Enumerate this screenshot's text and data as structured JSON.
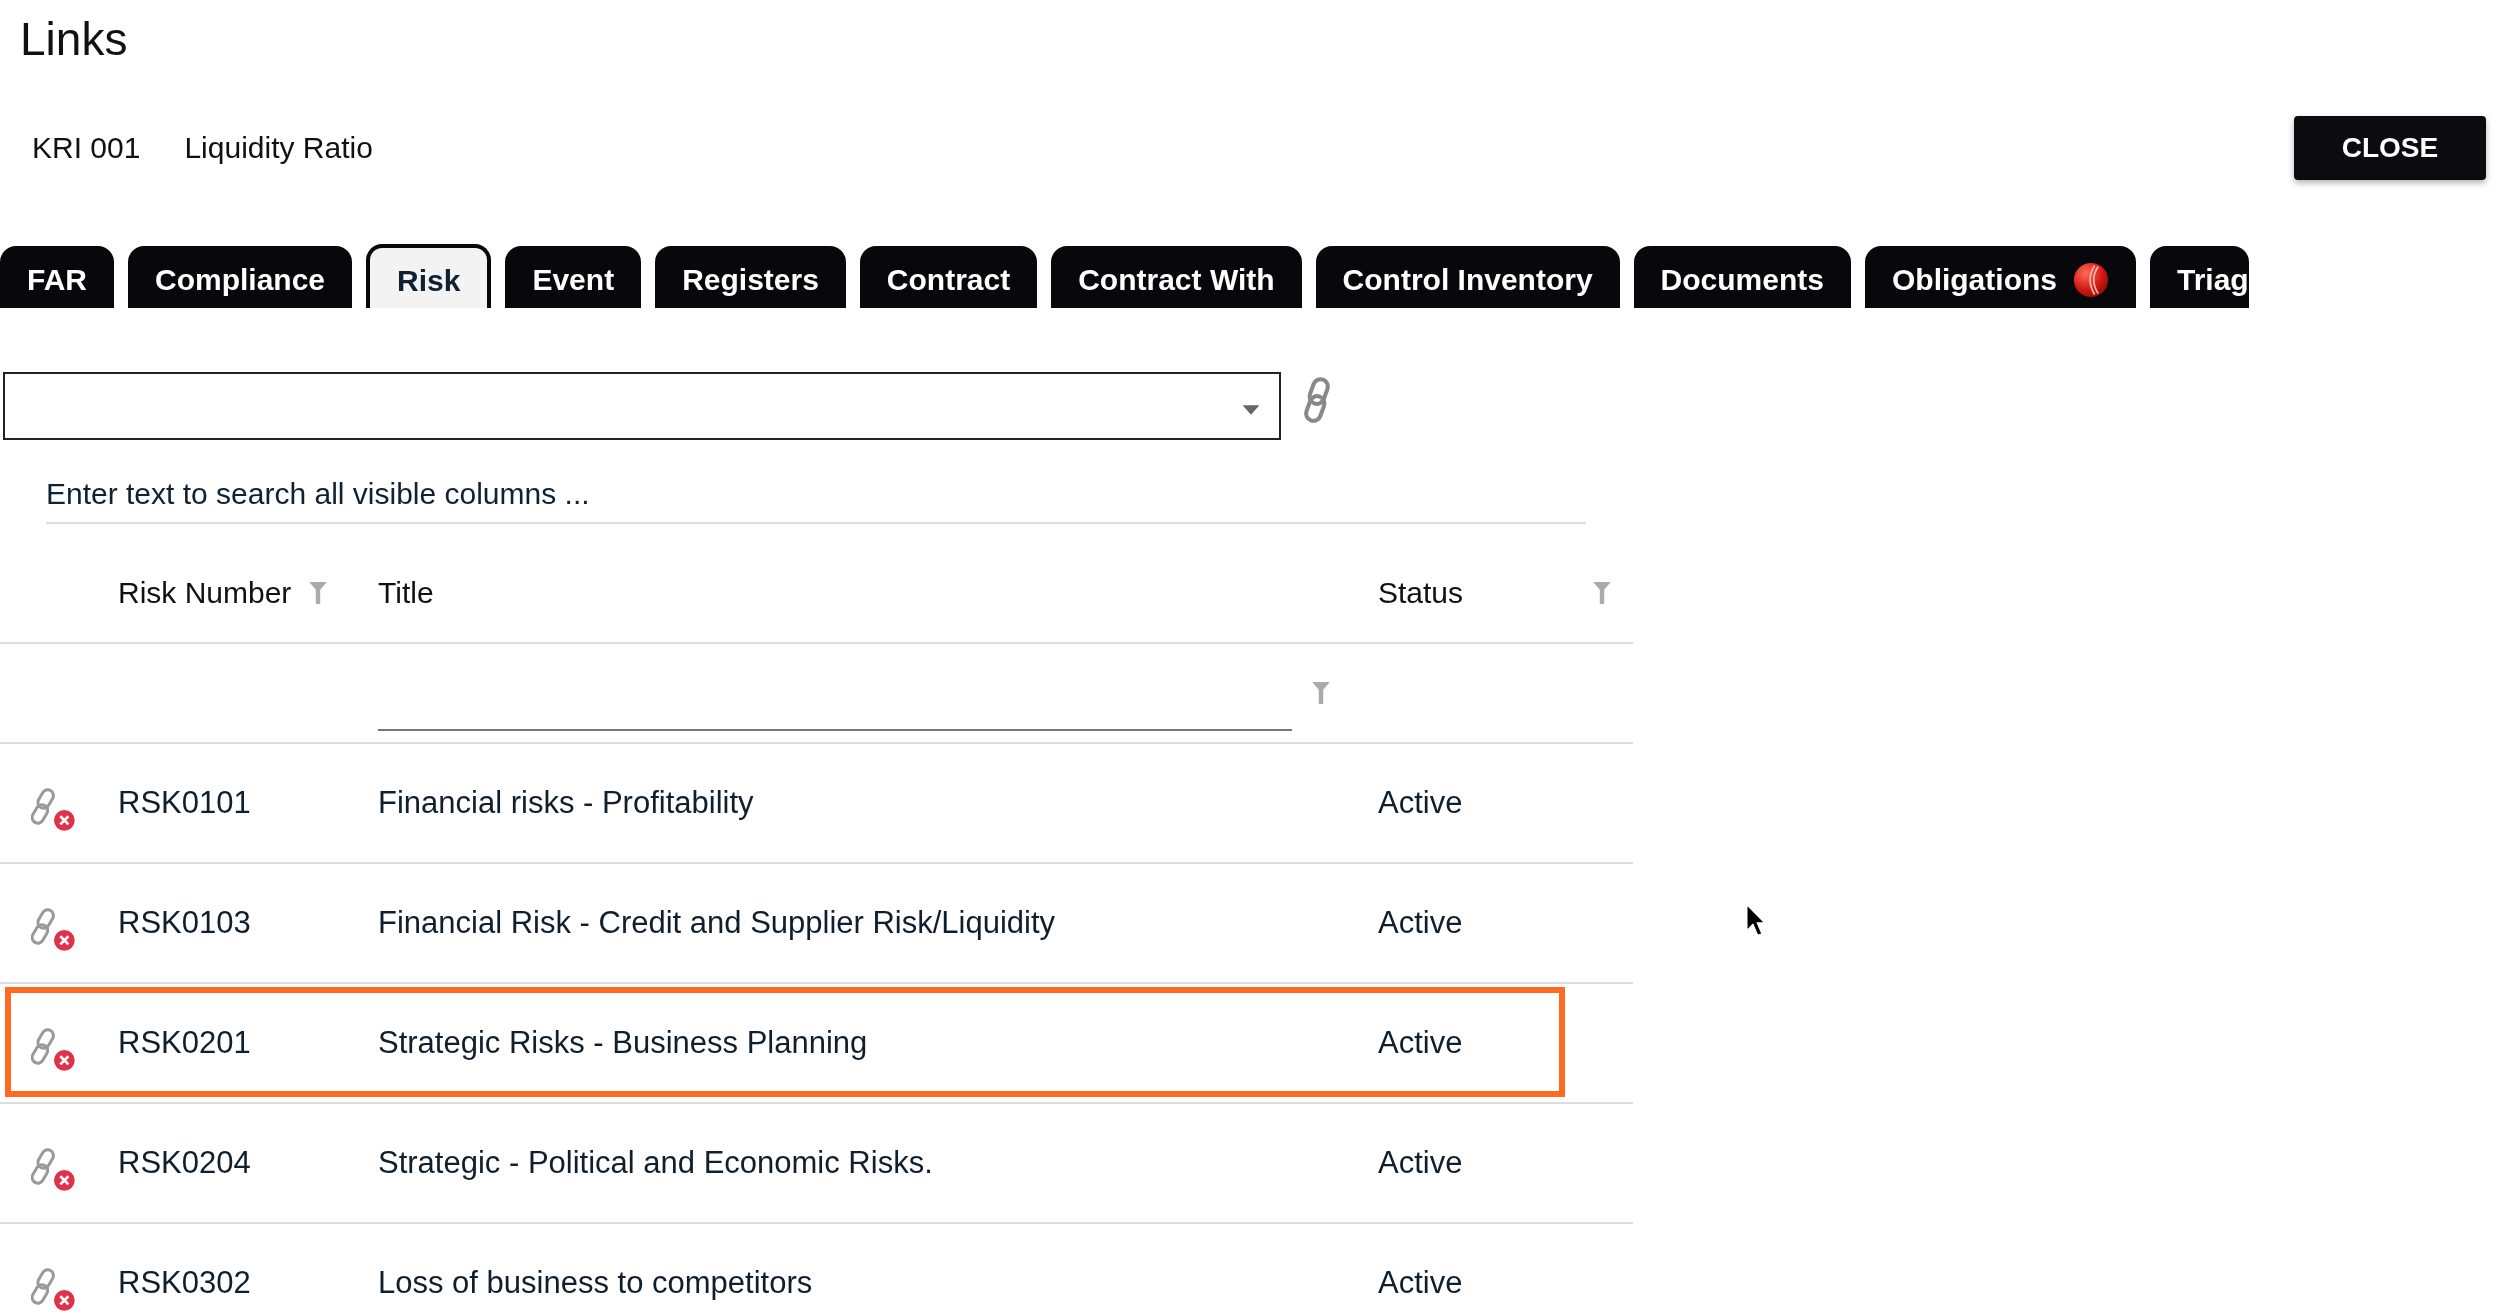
{
  "dialog": {
    "title": "Links",
    "record_id": "KRI 001",
    "record_name": "Liquidity Ratio",
    "close_button": "CLOSE"
  },
  "tabs": [
    {
      "label": "FAR",
      "selected": false,
      "badge": false
    },
    {
      "label": "Compliance",
      "selected": false,
      "badge": false
    },
    {
      "label": "Risk",
      "selected": true,
      "badge": false
    },
    {
      "label": "Event",
      "selected": false,
      "badge": false
    },
    {
      "label": "Registers",
      "selected": false,
      "badge": false
    },
    {
      "label": "Contract",
      "selected": false,
      "badge": false
    },
    {
      "label": "Contract With",
      "selected": false,
      "badge": false
    },
    {
      "label": "Control Inventory",
      "selected": false,
      "badge": false
    },
    {
      "label": "Documents",
      "selected": false,
      "badge": false
    },
    {
      "label": "Obligations",
      "selected": false,
      "badge": true
    },
    {
      "label": "Triag",
      "selected": false,
      "badge": false
    }
  ],
  "search": {
    "placeholder": "Enter text to search all visible columns ..."
  },
  "table": {
    "columns": [
      "Risk Number",
      "Title",
      "Status"
    ],
    "rows": [
      {
        "number": "RSK0101",
        "title": "Financial risks - Profitability",
        "status": "Active",
        "highlighted": false
      },
      {
        "number": "RSK0103",
        "title": "Financial Risk - Credit and Supplier Risk/Liquidity",
        "status": "Active",
        "highlighted": false
      },
      {
        "number": "RSK0201",
        "title": "Strategic Risks - Business Planning",
        "status": "Active",
        "highlighted": true
      },
      {
        "number": "RSK0204",
        "title": "Strategic - Political and Economic Risks.",
        "status": "Active",
        "highlighted": false
      },
      {
        "number": "RSK0302",
        "title": "Loss of business to competitors",
        "status": "Active",
        "highlighted": false
      }
    ]
  }
}
